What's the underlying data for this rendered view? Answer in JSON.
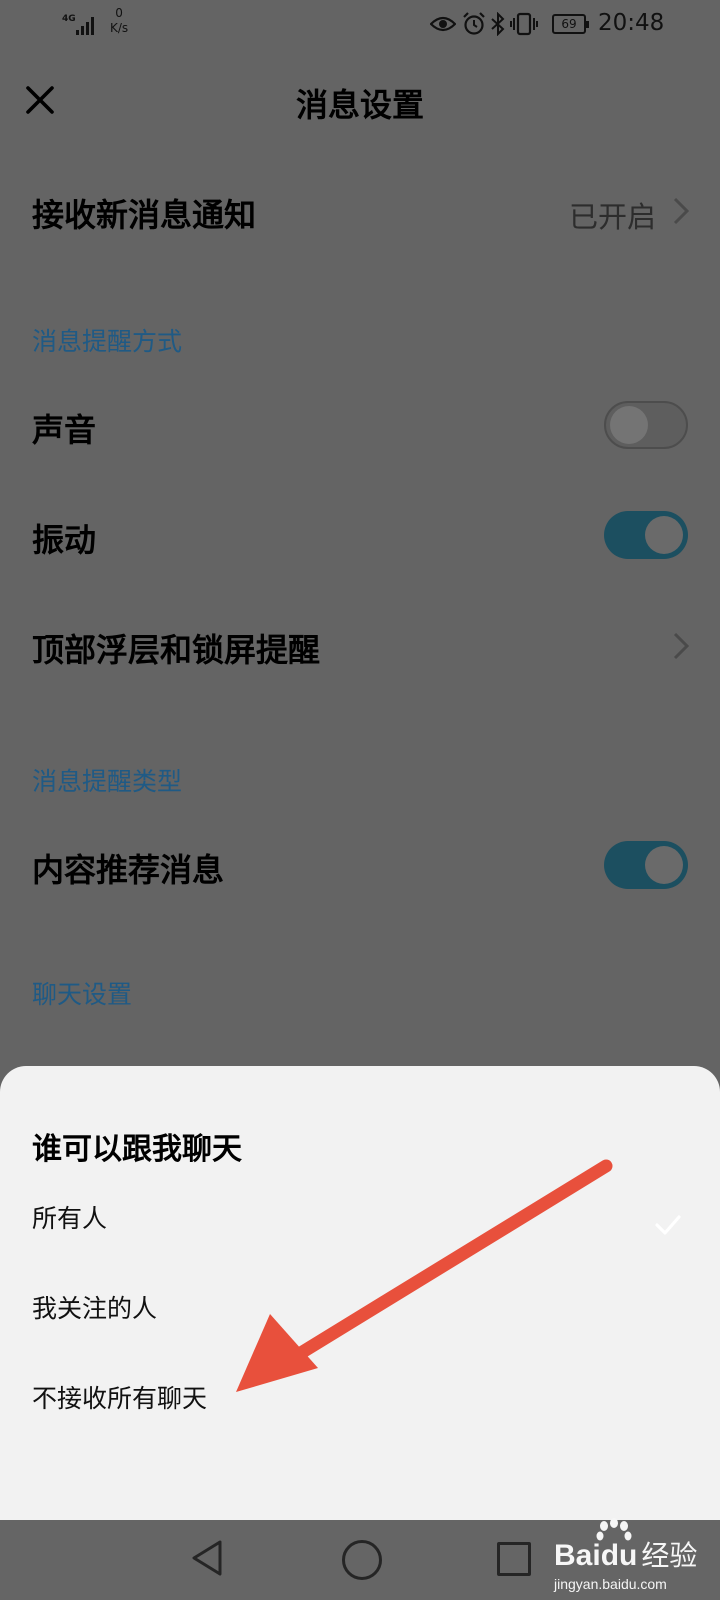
{
  "status_bar": {
    "network_type": "4G",
    "net_speed_value": "0",
    "net_speed_unit": "K/s",
    "battery": "69",
    "time": "20:48",
    "icons": [
      "eye-icon",
      "alarm-icon",
      "bluetooth-icon",
      "vibrate-icon"
    ]
  },
  "header": {
    "title": "消息设置",
    "close_icon": "close-icon"
  },
  "settings": {
    "new_message_label": "接收新消息通知",
    "new_message_value": "已开启",
    "section_reminder_method": "消息提醒方式",
    "sound_label": "声音",
    "sound_on": false,
    "vibrate_label": "振动",
    "vibrate_on": true,
    "overlay_label": "顶部浮层和锁屏提醒",
    "section_reminder_type": "消息提醒类型",
    "content_recommend_label": "内容推荐消息",
    "content_recommend_on": true,
    "section_chat": "聊天设置"
  },
  "sheet": {
    "title": "谁可以跟我聊天",
    "options": [
      {
        "label": "所有人",
        "selected": true
      },
      {
        "label": "我关注的人",
        "selected": false
      },
      {
        "label": "不接收所有聊天",
        "selected": false
      }
    ]
  },
  "annotation": {
    "arrow_color": "#e8503c"
  },
  "nav_bar": {
    "buttons": [
      "back-icon",
      "home-icon",
      "recents-icon"
    ]
  },
  "watermark": {
    "logo": "Bai",
    "logo_suffix": "du",
    "product": "经验",
    "url": "jingyan.baidu.com"
  },
  "colors": {
    "toggle_on": "#1c4f60",
    "section_text": "#1f5a85",
    "overlay": "#646464",
    "sheet_bg": "#f2f2f2"
  }
}
